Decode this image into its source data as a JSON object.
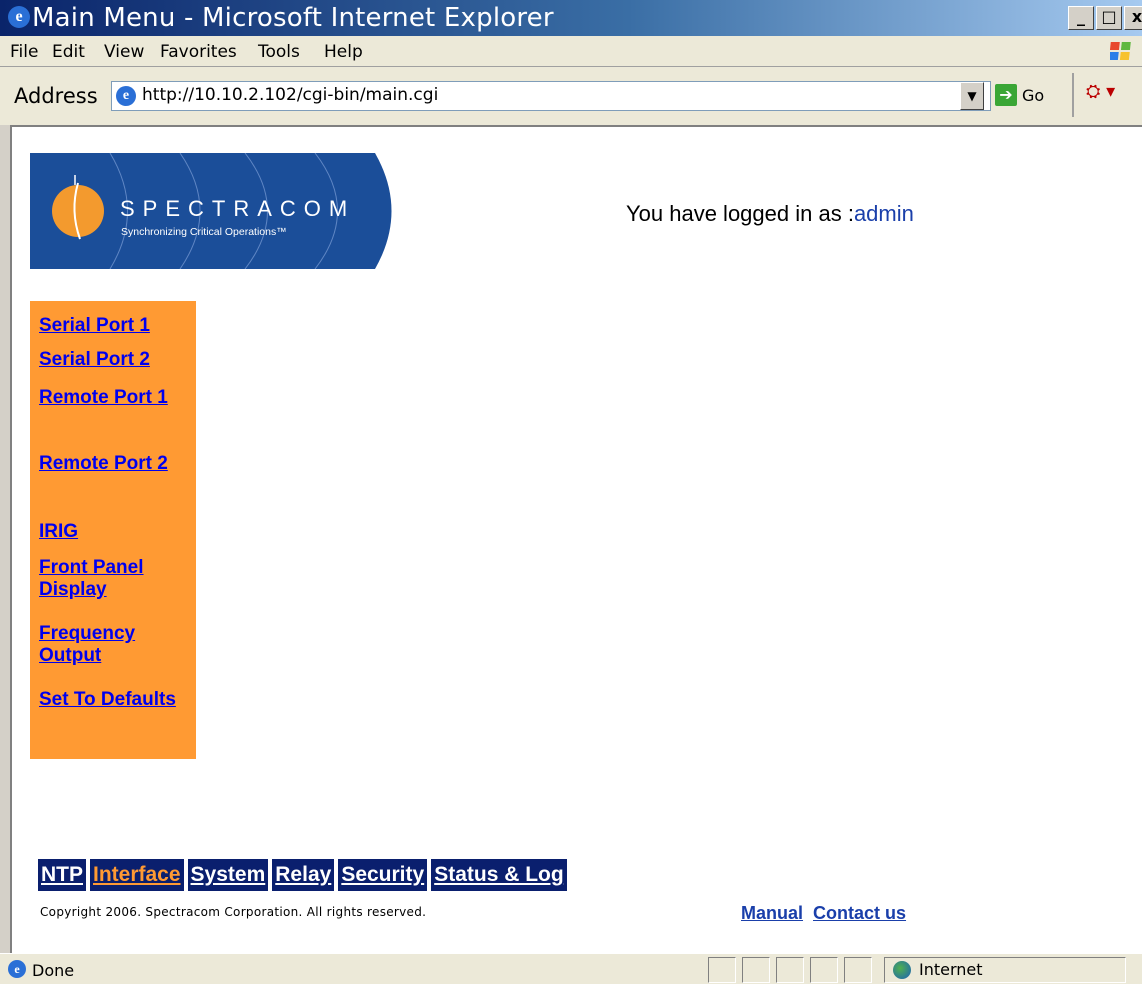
{
  "window": {
    "title": "Main Menu - Microsoft Internet Explorer",
    "minimize": "_",
    "maximize": "□",
    "close": "x"
  },
  "menubar": {
    "items": [
      "File",
      "Edit",
      "View",
      "Favorites",
      "Tools",
      "Help"
    ]
  },
  "addressbar": {
    "label": "Address",
    "url": "http://10.10.2.102/cgi-bin/main.cgi",
    "go_label": "Go"
  },
  "logo": {
    "brand": "SPECTRACOM",
    "tagline": "Synchronizing Critical Operations™"
  },
  "login": {
    "prefix": "You have logged in as :",
    "user": "admin"
  },
  "sidenav": {
    "items": [
      {
        "label": "Serial Port 1"
      },
      {
        "label": "Serial Port 2"
      },
      {
        "label": "Remote Port 1"
      },
      {
        "label": "Remote Port 2"
      },
      {
        "label": "IRIG"
      },
      {
        "label": "Front Panel Display"
      },
      {
        "label": "Frequency Output"
      },
      {
        "label": "Set To Defaults"
      }
    ]
  },
  "tabs": {
    "items": [
      {
        "label": "NTP",
        "active": false
      },
      {
        "label": "Interface",
        "active": true
      },
      {
        "label": "System",
        "active": false
      },
      {
        "label": "Relay",
        "active": false
      },
      {
        "label": "Security",
        "active": false
      },
      {
        "label": "Status & Log",
        "active": false
      }
    ]
  },
  "footer": {
    "copyright": "Copyright 2006. Spectracom Corporation. All rights reserved.",
    "manual": "Manual",
    "contact": "Contact us"
  },
  "statusbar": {
    "status": "Done",
    "zone": "Internet"
  },
  "colors": {
    "nav_bg": "#ff9a33",
    "tab_bg": "#0a1f6e",
    "link": "#0000ee"
  }
}
